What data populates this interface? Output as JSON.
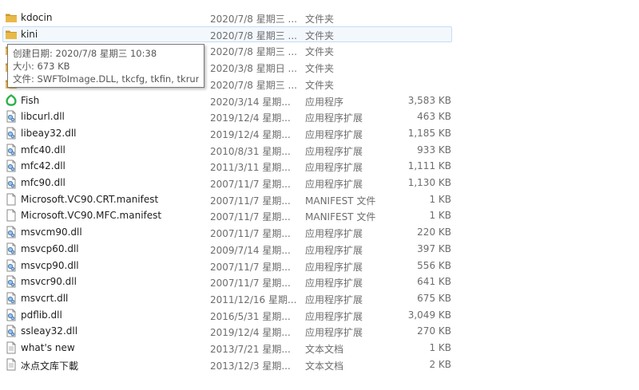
{
  "colors": {
    "folder": "#e8b948",
    "folder_dark": "#c99a2e",
    "fish_green": "#2fb24a",
    "hover_bg": "#f3f8fd",
    "hover_border": "#c6dcf2"
  },
  "tooltip": {
    "line1": "创建日期: 2020/7/8 星期三 10:38",
    "line2": "大小: 673 KB",
    "line3": "文件: SWFToImage.DLL, tkcfg, tkfin, tkrun"
  },
  "files": [
    {
      "name": "kdocin",
      "date": "2020/7/8 星期三 ...",
      "type": "文件夹",
      "size": "",
      "icon": "folder-icon"
    },
    {
      "name": "kini",
      "date": "2020/7/8 星期三 ...",
      "type": "文件夹",
      "size": "",
      "icon": "folder-icon"
    },
    {
      "name": "",
      "date": "2020/7/8 星期三 ...",
      "type": "文件夹",
      "size": "",
      "icon": "folder-icon"
    },
    {
      "name": "",
      "date": "2020/3/8 星期日 ...",
      "type": "文件夹",
      "size": "",
      "icon": "folder-icon"
    },
    {
      "name": "",
      "date": "2020/7/8 星期三 ...",
      "type": "文件夹",
      "size": "",
      "icon": "folder-icon"
    },
    {
      "name": "Fish",
      "date": "2020/3/14 星期...",
      "type": "应用程序",
      "size": "3,583 KB",
      "icon": "fish-app-icon"
    },
    {
      "name": "libcurl.dll",
      "date": "2019/12/4 星期...",
      "type": "应用程序扩展",
      "size": "463 KB",
      "icon": "dll-icon"
    },
    {
      "name": "libeay32.dll",
      "date": "2019/12/4 星期...",
      "type": "应用程序扩展",
      "size": "1,185 KB",
      "icon": "dll-icon"
    },
    {
      "name": "mfc40.dll",
      "date": "2010/8/31 星期...",
      "type": "应用程序扩展",
      "size": "933 KB",
      "icon": "dll-icon"
    },
    {
      "name": "mfc42.dll",
      "date": "2011/3/11 星期...",
      "type": "应用程序扩展",
      "size": "1,111 KB",
      "icon": "dll-icon"
    },
    {
      "name": "mfc90.dll",
      "date": "2007/11/7 星期...",
      "type": "应用程序扩展",
      "size": "1,130 KB",
      "icon": "dll-icon"
    },
    {
      "name": "Microsoft.VC90.CRT.manifest",
      "date": "2007/11/7 星期...",
      "type": "MANIFEST 文件",
      "size": "1 KB",
      "icon": "file-icon"
    },
    {
      "name": "Microsoft.VC90.MFC.manifest",
      "date": "2007/11/7 星期...",
      "type": "MANIFEST 文件",
      "size": "1 KB",
      "icon": "file-icon"
    },
    {
      "name": "msvcm90.dll",
      "date": "2007/11/7 星期...",
      "type": "应用程序扩展",
      "size": "220 KB",
      "icon": "dll-icon"
    },
    {
      "name": "msvcp60.dll",
      "date": "2009/7/14 星期...",
      "type": "应用程序扩展",
      "size": "397 KB",
      "icon": "dll-icon"
    },
    {
      "name": "msvcp90.dll",
      "date": "2007/11/7 星期...",
      "type": "应用程序扩展",
      "size": "556 KB",
      "icon": "dll-icon"
    },
    {
      "name": "msvcr90.dll",
      "date": "2007/11/7 星期...",
      "type": "应用程序扩展",
      "size": "641 KB",
      "icon": "dll-icon"
    },
    {
      "name": "msvcrt.dll",
      "date": "2011/12/16 星期...",
      "type": "应用程序扩展",
      "size": "675 KB",
      "icon": "dll-icon"
    },
    {
      "name": "pdflib.dll",
      "date": "2016/5/31 星期...",
      "type": "应用程序扩展",
      "size": "3,049 KB",
      "icon": "dll-icon"
    },
    {
      "name": "ssleay32.dll",
      "date": "2019/12/4 星期...",
      "type": "应用程序扩展",
      "size": "270 KB",
      "icon": "dll-icon"
    },
    {
      "name": "what's new",
      "date": "2013/7/21 星期...",
      "type": "文本文档",
      "size": "1 KB",
      "icon": "text-file-icon"
    },
    {
      "name": "冰点文库下載",
      "date": "2013/12/3 星期...",
      "type": "文本文档",
      "size": "2 KB",
      "icon": "text-file-icon"
    }
  ]
}
